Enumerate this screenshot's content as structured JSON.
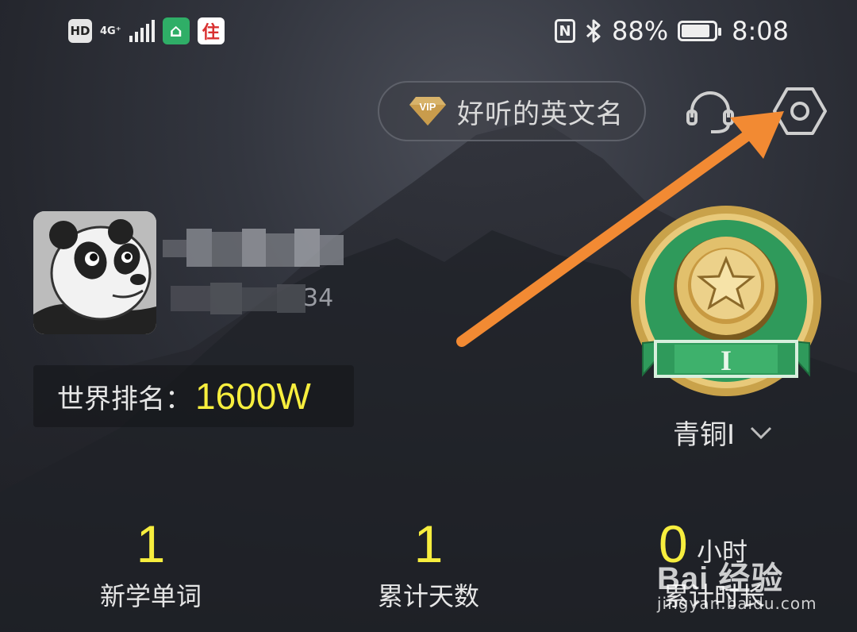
{
  "status_bar": {
    "hd": "HD",
    "network": "4G⁺",
    "app_icon_2": "住",
    "nfc": "N",
    "battery_percent": "88%",
    "battery_level": 0.88,
    "time": "8:08"
  },
  "header": {
    "vip_badge": "VIP",
    "vip_title": "好听的英文名"
  },
  "profile": {
    "uid_tail": "34",
    "rank_label": "世界排名：",
    "rank_value": "1600W",
    "medal_mark": "I",
    "level_name": "青铜I"
  },
  "stats": [
    {
      "value": "1",
      "label": "新学单词"
    },
    {
      "value": "1",
      "label": "累计天数"
    },
    {
      "value": "0",
      "unit": "小时",
      "label": "累计时长"
    }
  ],
  "watermark": {
    "main": "Bai 经验",
    "sub": "jingyan.baidu.com"
  },
  "colors": {
    "accent_yellow": "#f7ee3e",
    "arrow_orange": "#f28a33",
    "medal_green": "#2f9a5b",
    "medal_gold": "#c9a24a"
  },
  "icons": [
    "vip-gem-icon",
    "headset-icon",
    "settings-gear-icon",
    "chevron-down-icon",
    "bluetooth-icon",
    "nfc-icon",
    "battery-icon"
  ]
}
